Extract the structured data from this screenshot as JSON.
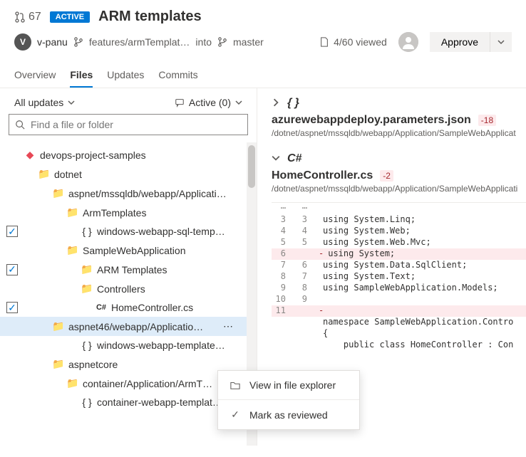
{
  "header": {
    "pr_number": "67",
    "status_badge": "ACTIVE",
    "title": "ARM templates",
    "author_initial": "V",
    "author_name": "v-panu",
    "source_branch": "features/armTemplat…",
    "into_label": "into",
    "target_branch": "master",
    "viewed_count": "4/60 viewed",
    "approve_label": "Approve"
  },
  "tabs": [
    "Overview",
    "Files",
    "Updates",
    "Commits"
  ],
  "filter": {
    "left": "All updates",
    "right": "Active (0)"
  },
  "search": {
    "placeholder": "Find a file or folder"
  },
  "tree": {
    "root": "devops-project-samples",
    "dotnet": "dotnet",
    "aspnet_app": "aspnet/mssqldb/webapp/Applicati…",
    "arm_templates": "ArmTemplates",
    "win_sql": "windows-webapp-sql-temp…",
    "sample_web": "SampleWebApplication",
    "arm_templates2": "ARM Templates",
    "controllers": "Controllers",
    "home_controller": "HomeController.cs",
    "aspnet46": "aspnet46/webapp/Applicatio…",
    "win_template": "windows-webapp-template…",
    "aspnetcore": "aspnetcore",
    "container_arm": "container/Application/ArmT…",
    "container_template": "container-webapp-templat…"
  },
  "files": {
    "file1": {
      "name": "azurewebappdeploy.parameters.json",
      "badge": "-18",
      "path": "/dotnet/aspnet/mssqldb/webapp/Application/SampleWebApplicat"
    },
    "file2": {
      "lang": "C#",
      "name": "HomeController.cs",
      "badge": "-2",
      "path": "/dotnet/aspnet/mssqldb/webapp/Application/SampleWebApplicati"
    }
  },
  "code": {
    "lines": [
      {
        "l": "3",
        "r": "3",
        "op": " ",
        "text": "using System.Linq;"
      },
      {
        "l": "4",
        "r": "4",
        "op": " ",
        "text": "using System.Web;"
      },
      {
        "l": "5",
        "r": "5",
        "op": " ",
        "text": "using System.Web.Mvc;"
      },
      {
        "l": "6",
        "r": "",
        "op": "-",
        "text": "using System;"
      },
      {
        "l": "7",
        "r": "6",
        "op": " ",
        "text": "using System.Data.SqlClient;"
      },
      {
        "l": "8",
        "r": "7",
        "op": " ",
        "text": "using System.Text;"
      },
      {
        "l": "9",
        "r": "8",
        "op": " ",
        "text": "using SampleWebApplication.Models;"
      },
      {
        "l": "10",
        "r": "9",
        "op": " ",
        "text": ""
      },
      {
        "l": "11",
        "r": "",
        "op": "-",
        "text": ""
      },
      {
        "l": "",
        "r": "",
        "op": " ",
        "text": "namespace SampleWebApplication.Contro"
      },
      {
        "l": "",
        "r": "",
        "op": " ",
        "text": "{"
      },
      {
        "l": "",
        "r": "",
        "op": " ",
        "text": "    public class HomeController : Con"
      }
    ]
  },
  "context_menu": {
    "view": "View in file explorer",
    "mark": "Mark as reviewed"
  }
}
